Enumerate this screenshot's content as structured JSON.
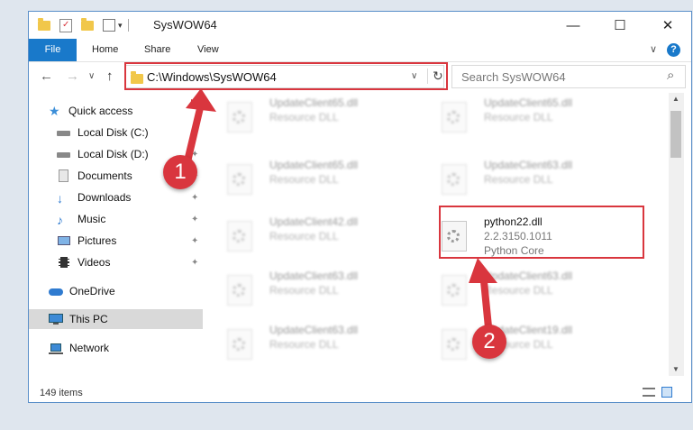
{
  "window": {
    "title": "SysWOW64",
    "controls": {
      "minimize": "—",
      "maximize": "☐",
      "close": "✕"
    }
  },
  "ribbon": {
    "tabs": [
      "File",
      "Home",
      "Share",
      "View"
    ],
    "expand": "∨",
    "help": "?"
  },
  "address": {
    "path": "C:\\Windows\\SysWOW64",
    "dropdown": "∨",
    "refresh": "↻"
  },
  "search": {
    "placeholder": "Search SysWOW64",
    "icon": "⌕"
  },
  "nav": {
    "back": "←",
    "forward": "→",
    "recent": "∨",
    "up": "↑"
  },
  "sidebar": {
    "items": [
      {
        "label": "Quick access",
        "icon": "star-icon",
        "pinned": false
      },
      {
        "label": "Local Disk (C:)",
        "icon": "drive-icon",
        "pinned": false
      },
      {
        "label": "Local Disk (D:)",
        "icon": "drive-icon",
        "pinned": true
      },
      {
        "label": "Documents",
        "icon": "documents-icon",
        "pinned": true
      },
      {
        "label": "Downloads",
        "icon": "download-icon",
        "pinned": true
      },
      {
        "label": "Music",
        "icon": "music-icon",
        "pinned": true
      },
      {
        "label": "Pictures",
        "icon": "pictures-icon",
        "pinned": true
      },
      {
        "label": "Videos",
        "icon": "videos-icon",
        "pinned": true
      },
      {
        "label": "OneDrive",
        "icon": "cloud-icon",
        "pinned": false
      },
      {
        "label": "This PC",
        "icon": "computer-icon",
        "pinned": false
      },
      {
        "label": "Network",
        "icon": "network-icon",
        "pinned": false
      }
    ],
    "pin_glyph": "📌"
  },
  "files": {
    "items": [
      {
        "name": "UpdateClient65.dll",
        "sub": "Resource DLL"
      },
      {
        "name": "UpdateClient65.dll",
        "sub": "Resource DLL"
      },
      {
        "name": "UpdateClient65.dll",
        "sub": "Resource DLL"
      },
      {
        "name": "UpdateClient63.dll",
        "sub": "Resource DLL"
      },
      {
        "name": "UpdateClient42.dll",
        "sub": "Resource DLL"
      },
      {
        "name": "UpdateClient63.dll",
        "sub": "Resource DLL"
      },
      {
        "name": "UpdateClient63.dll",
        "sub": "Resource DLL"
      },
      {
        "name": "UpdateClient63.dll",
        "sub": "Resource DLL"
      },
      {
        "name": "UpdateClient19.dll",
        "sub": "Resource DLL"
      }
    ],
    "highlighted": {
      "name": "python22.dll",
      "version": "2.2.3150.1011",
      "description": "Python Core"
    }
  },
  "status": {
    "count": "149 items"
  },
  "annotations": {
    "step1": "1",
    "step2": "2",
    "color": "#d9363e"
  }
}
